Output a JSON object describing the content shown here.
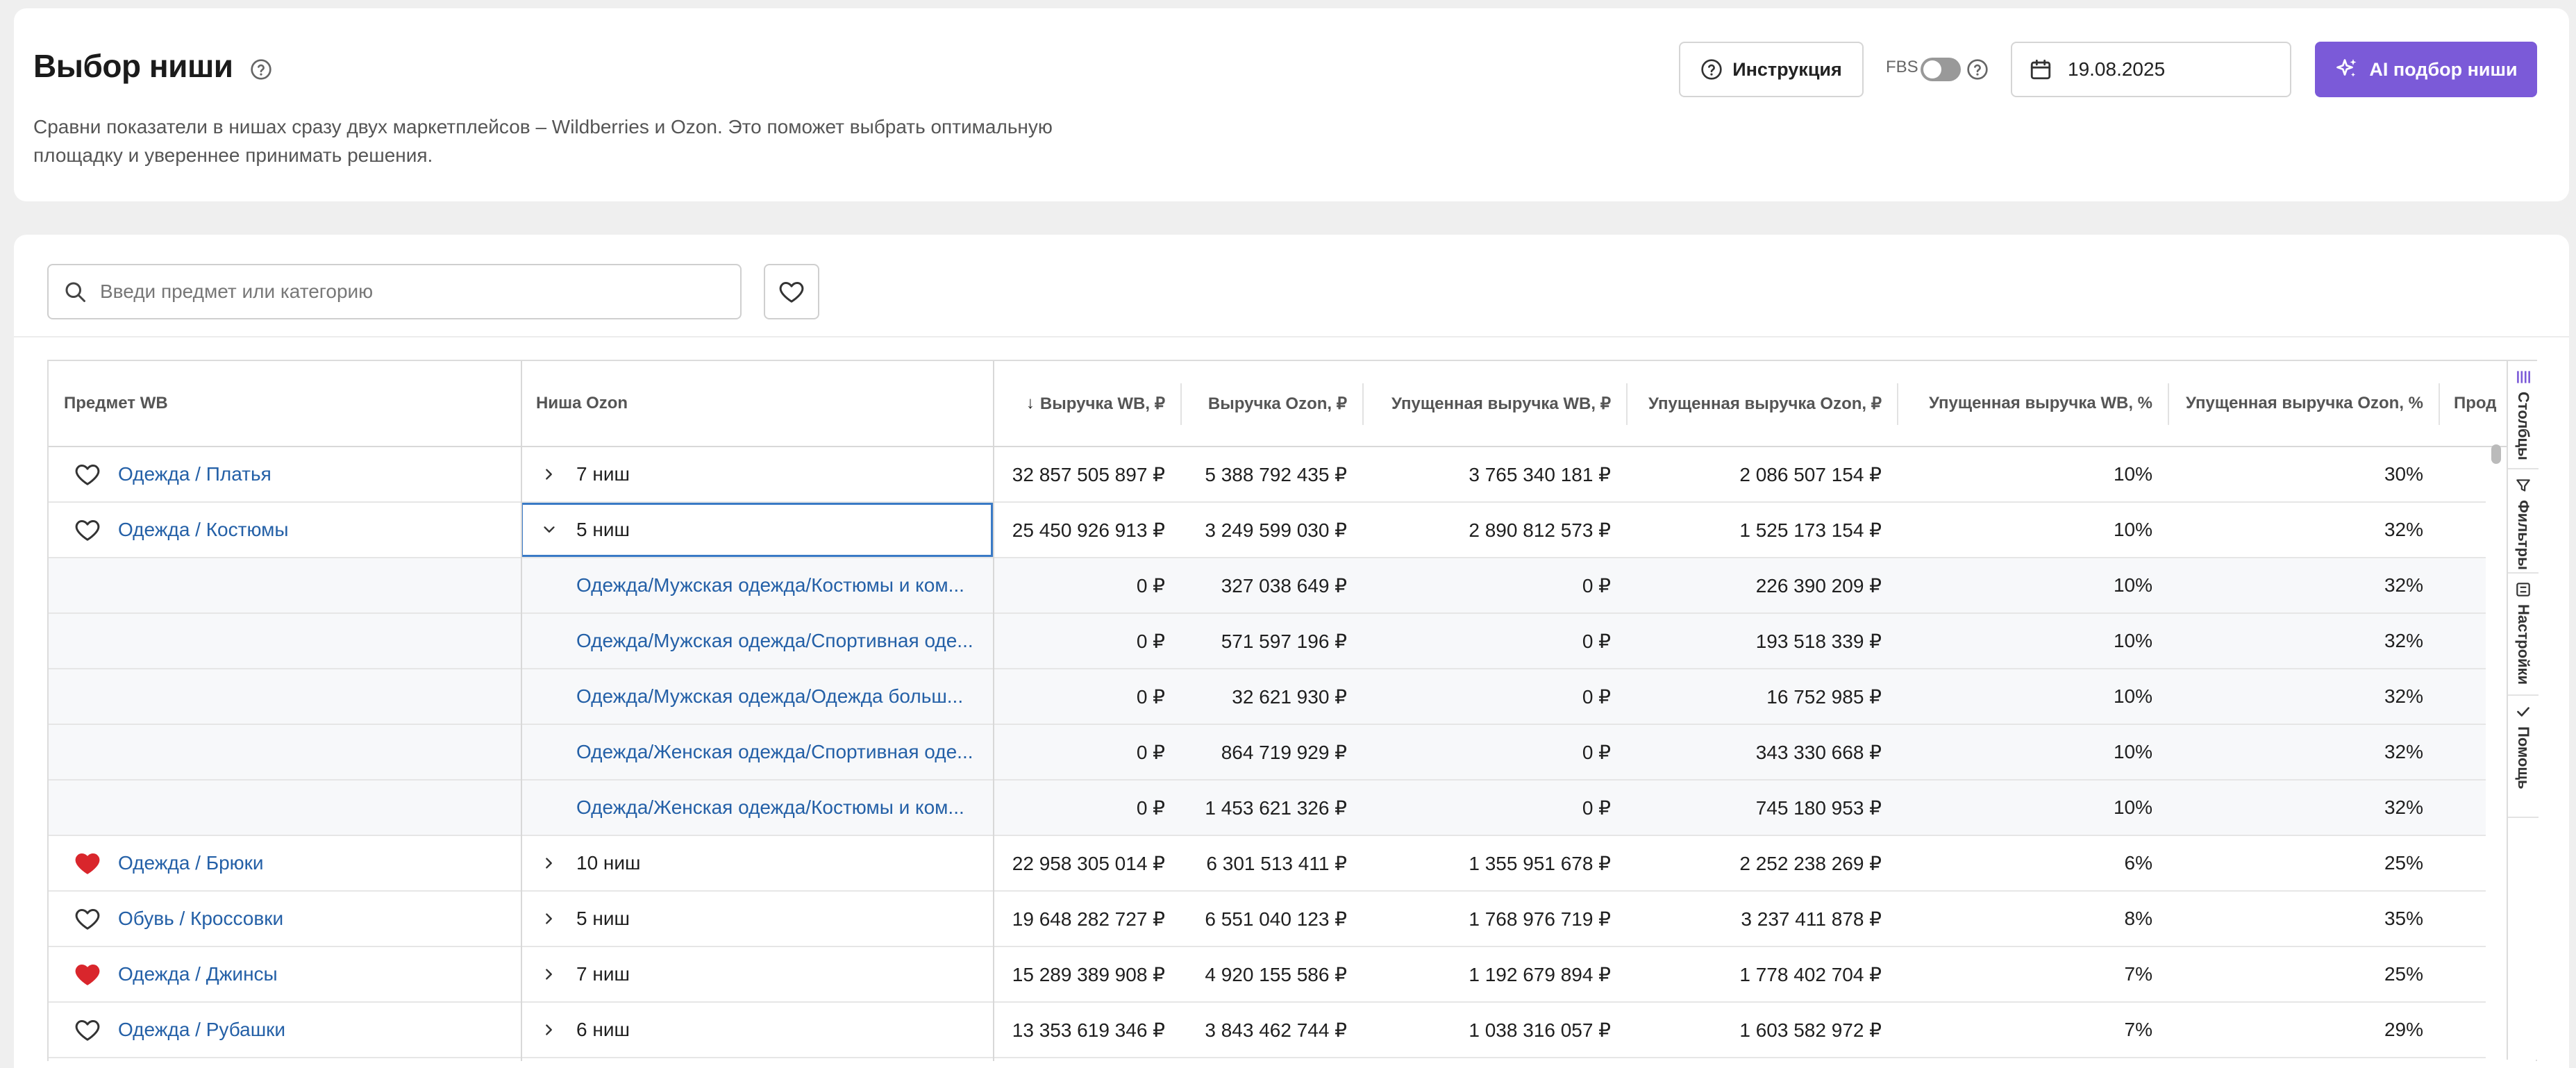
{
  "header": {
    "title": "Выбор ниши",
    "description": "Сравни показатели в нишах сразу двух маркетплейсов – Wildberries и Ozon. Это поможет выбрать оптимальную площадку и увереннее принимать решения.",
    "instruction_label": "Инструкция",
    "fbs_label": "FBS",
    "date_value": "19.08.2025",
    "ai_button_label": "AI подбор ниши",
    "accent_color": "#7b5ad8"
  },
  "search": {
    "placeholder": "Введи предмет или категорию"
  },
  "table": {
    "columns": [
      "Предмет WB",
      "Ниша Ozon",
      "Выручка WB, ₽",
      "Выручка Ozon, ₽",
      "Упущенная выручка WB, ₽",
      "Упущенная выручка Ozon, ₽",
      "Упущенная выручка WB, %",
      "Упущенная выручка Ozon, %",
      "Прод"
    ],
    "sort_indicator": "↓",
    "rows": [
      {
        "subject": "Одежда / Платья",
        "fav": false,
        "niches": "7 ниш",
        "expanded": false,
        "rev_wb": "32 857 505 897 ₽",
        "rev_ozon": "5 388 792 435 ₽",
        "lost_wb": "3 765 340 181 ₽",
        "lost_ozon": "2 086 507 154 ₽",
        "lost_wb_pct": "10%",
        "lost_ozon_pct": "30%"
      },
      {
        "subject": "Одежда / Костюмы",
        "fav": false,
        "niches": "5 ниш",
        "expanded": true,
        "rev_wb": "25 450 926 913 ₽",
        "rev_ozon": "3 249 599 030 ₽",
        "lost_wb": "2 890 812 573 ₽",
        "lost_ozon": "1 525 173 154 ₽",
        "lost_wb_pct": "10%",
        "lost_ozon_pct": "32%"
      },
      {
        "child": true,
        "niche": "Одежда/Мужская одежда/Костюмы и ком...",
        "rev_wb": "0 ₽",
        "rev_ozon": "327 038 649 ₽",
        "lost_wb": "0 ₽",
        "lost_ozon": "226 390 209 ₽",
        "lost_wb_pct": "10%",
        "lost_ozon_pct": "32%"
      },
      {
        "child": true,
        "niche": "Одежда/Мужская одежда/Спортивная оде...",
        "rev_wb": "0 ₽",
        "rev_ozon": "571 597 196 ₽",
        "lost_wb": "0 ₽",
        "lost_ozon": "193 518 339 ₽",
        "lost_wb_pct": "10%",
        "lost_ozon_pct": "32%"
      },
      {
        "child": true,
        "niche": "Одежда/Мужская одежда/Одежда больш...",
        "rev_wb": "0 ₽",
        "rev_ozon": "32 621 930 ₽",
        "lost_wb": "0 ₽",
        "lost_ozon": "16 752 985 ₽",
        "lost_wb_pct": "10%",
        "lost_ozon_pct": "32%"
      },
      {
        "child": true,
        "niche": "Одежда/Женская одежда/Спортивная оде...",
        "rev_wb": "0 ₽",
        "rev_ozon": "864 719 929 ₽",
        "lost_wb": "0 ₽",
        "lost_ozon": "343 330 668 ₽",
        "lost_wb_pct": "10%",
        "lost_ozon_pct": "32%"
      },
      {
        "child": true,
        "niche": "Одежда/Женская одежда/Костюмы и ком...",
        "rev_wb": "0 ₽",
        "rev_ozon": "1 453 621 326 ₽",
        "lost_wb": "0 ₽",
        "lost_ozon": "745 180 953 ₽",
        "lost_wb_pct": "10%",
        "lost_ozon_pct": "32%"
      },
      {
        "subject": "Одежда / Брюки",
        "fav": true,
        "niches": "10 ниш",
        "expanded": false,
        "rev_wb": "22 958 305 014 ₽",
        "rev_ozon": "6 301 513 411 ₽",
        "lost_wb": "1 355 951 678 ₽",
        "lost_ozon": "2 252 238 269 ₽",
        "lost_wb_pct": "6%",
        "lost_ozon_pct": "25%"
      },
      {
        "subject": "Обувь / Кроссовки",
        "fav": false,
        "niches": "5 ниш",
        "expanded": false,
        "rev_wb": "19 648 282 727 ₽",
        "rev_ozon": "6 551 040 123 ₽",
        "lost_wb": "1 768 976 719 ₽",
        "lost_ozon": "3 237 411 878 ₽",
        "lost_wb_pct": "8%",
        "lost_ozon_pct": "35%"
      },
      {
        "subject": "Одежда / Джинсы",
        "fav": true,
        "niches": "7 ниш",
        "expanded": false,
        "rev_wb": "15 289 389 908 ₽",
        "rev_ozon": "4 920 155 586 ₽",
        "lost_wb": "1 192 679 894 ₽",
        "lost_ozon": "1 778 402 704 ₽",
        "lost_wb_pct": "7%",
        "lost_ozon_pct": "25%"
      },
      {
        "subject": "Одежда / Рубашки",
        "fav": false,
        "niches": "6 ниш",
        "expanded": false,
        "rev_wb": "13 353 619 346 ₽",
        "rev_ozon": "3 843 462 744 ₽",
        "lost_wb": "1 038 316 057 ₽",
        "lost_ozon": "1 603 582 972 ₽",
        "lost_wb_pct": "7%",
        "lost_ozon_pct": "29%"
      }
    ]
  },
  "side_panel": {
    "tabs": [
      {
        "label": "Столбцы",
        "icon": "columns-icon"
      },
      {
        "label": "Фильтры",
        "icon": "filter-icon"
      },
      {
        "label": "Настройки",
        "icon": "settings-icon"
      },
      {
        "label": "Помощь",
        "icon": "check-icon"
      }
    ]
  },
  "colors": {
    "link": "#2460a7",
    "fav_active": "#d9262c",
    "selected_border": "#3a7ac6"
  }
}
